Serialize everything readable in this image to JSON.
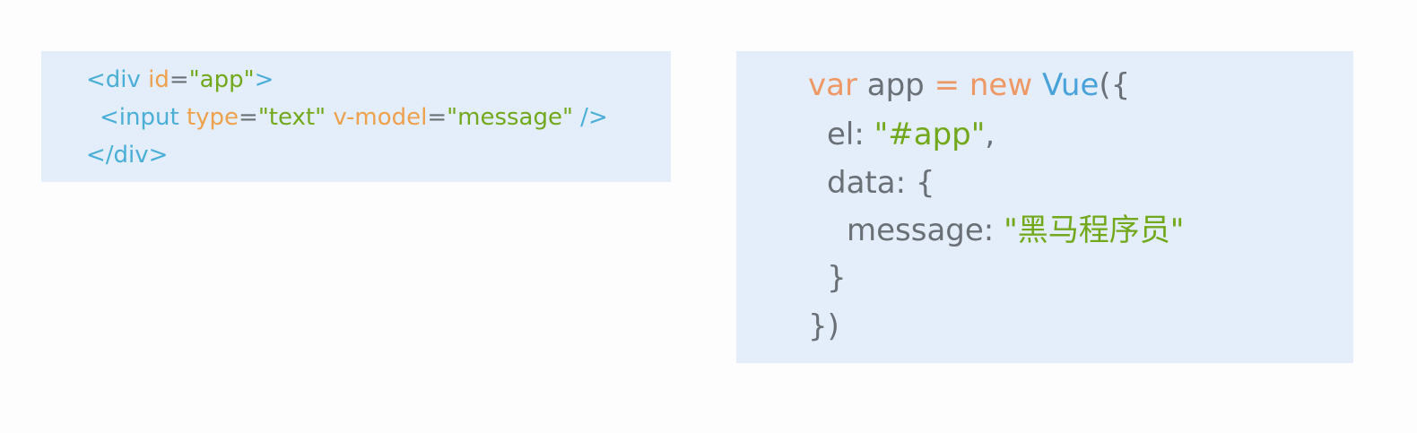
{
  "html_snippet": {
    "line1": {
      "open": "<div ",
      "attr": "id",
      "eq": "=",
      "value": "\"app\"",
      "close": ">"
    },
    "line2": {
      "open": "<input ",
      "attr1": "type",
      "eq1": "=",
      "value1": "\"text\"",
      "space": " ",
      "attr2": "v-model",
      "eq2": "=",
      "value2": "\"message\"",
      "close": " />"
    },
    "line3": {
      "close_tag": "</div>"
    }
  },
  "js_snippet": {
    "line1": {
      "kw_var": "var",
      "name": " app ",
      "op": "= ",
      "kw_new": "new ",
      "cls": "Vue",
      "paren": "({"
    },
    "line2": {
      "key": "el: ",
      "value": "\"#app\"",
      "comma": ","
    },
    "line3": {
      "text": "data: {"
    },
    "line4": {
      "key": "message: ",
      "value": "\"黑马程序员\""
    },
    "line5": {
      "text": "}"
    },
    "line6": {
      "text": "})"
    }
  },
  "colors": {
    "background": "#fdfdfd",
    "panel": "#e4eefa",
    "tag": "#4aaed6",
    "attribute": "#eea14d",
    "string": "#72a81c",
    "plain": "#6a7076",
    "keyword": "#ee9866",
    "class": "#4aa2da"
  }
}
